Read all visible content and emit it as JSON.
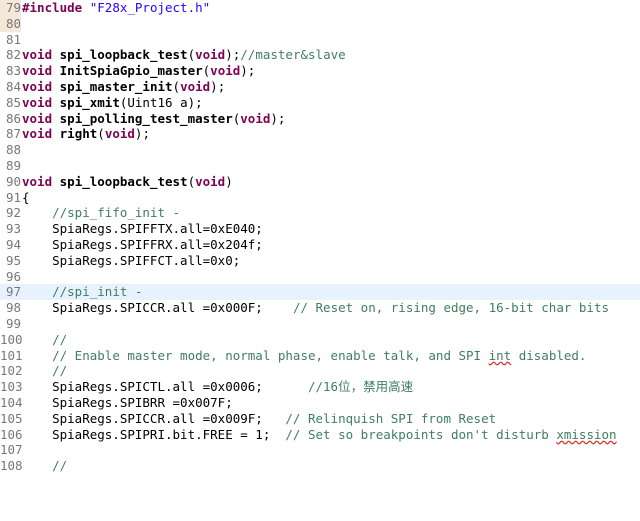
{
  "editor": {
    "current_line_number": "97",
    "lines": [
      {
        "n": "79",
        "code": "#include \"F28x_Project.h\""
      },
      {
        "n": "80",
        "code": ""
      },
      {
        "n": "81",
        "code": ""
      },
      {
        "n": "82",
        "code": "void spi_loopback_test(void);//master&slave"
      },
      {
        "n": "83",
        "code": "void InitSpiaGpio_master(void);"
      },
      {
        "n": "84",
        "code": "void spi_master_init(void);"
      },
      {
        "n": "85",
        "code": "void spi_xmit(Uint16 a);"
      },
      {
        "n": "86",
        "code": "void spi_polling_test_master(void);"
      },
      {
        "n": "87",
        "code": "void right(void);"
      },
      {
        "n": "88",
        "code": ""
      },
      {
        "n": "89",
        "code": ""
      },
      {
        "n": "90",
        "code": "void spi_loopback_test(void)"
      },
      {
        "n": "91",
        "code": "{"
      },
      {
        "n": "92",
        "code": "    //spi_fifo_init -"
      },
      {
        "n": "93",
        "code": "    SpiaRegs.SPIFFTX.all=0xE040;"
      },
      {
        "n": "94",
        "code": "    SpiaRegs.SPIFFRX.all=0x204f;"
      },
      {
        "n": "95",
        "code": "    SpiaRegs.SPIFFCT.all=0x0;"
      },
      {
        "n": "96",
        "code": ""
      },
      {
        "n": "97",
        "code": "    //spi_init -"
      },
      {
        "n": "98",
        "code": "    SpiaRegs.SPICCR.all =0x000F;    // Reset on, rising edge, 16-bit char bits"
      },
      {
        "n": "99",
        "code": ""
      },
      {
        "n": "100",
        "code": "    //"
      },
      {
        "n": "101",
        "code": "    // Enable master mode, normal phase, enable talk, and SPI int disabled."
      },
      {
        "n": "102",
        "code": "    //"
      },
      {
        "n": "103",
        "code": "    SpiaRegs.SPICTL.all =0x0006;      //16位，禁用高速"
      },
      {
        "n": "104",
        "code": "    SpiaRegs.SPIBRR =0x007F;"
      },
      {
        "n": "105",
        "code": "    SpiaRegs.SPICCR.all =0x009F;   // Relinquish SPI from Reset"
      },
      {
        "n": "106",
        "code": "    SpiaRegs.SPIPRI.bit.FREE = 1;  // Set so breakpoints don't disturb xmission"
      },
      {
        "n": "107",
        "code": ""
      },
      {
        "n": "108",
        "code": "    //"
      }
    ]
  }
}
